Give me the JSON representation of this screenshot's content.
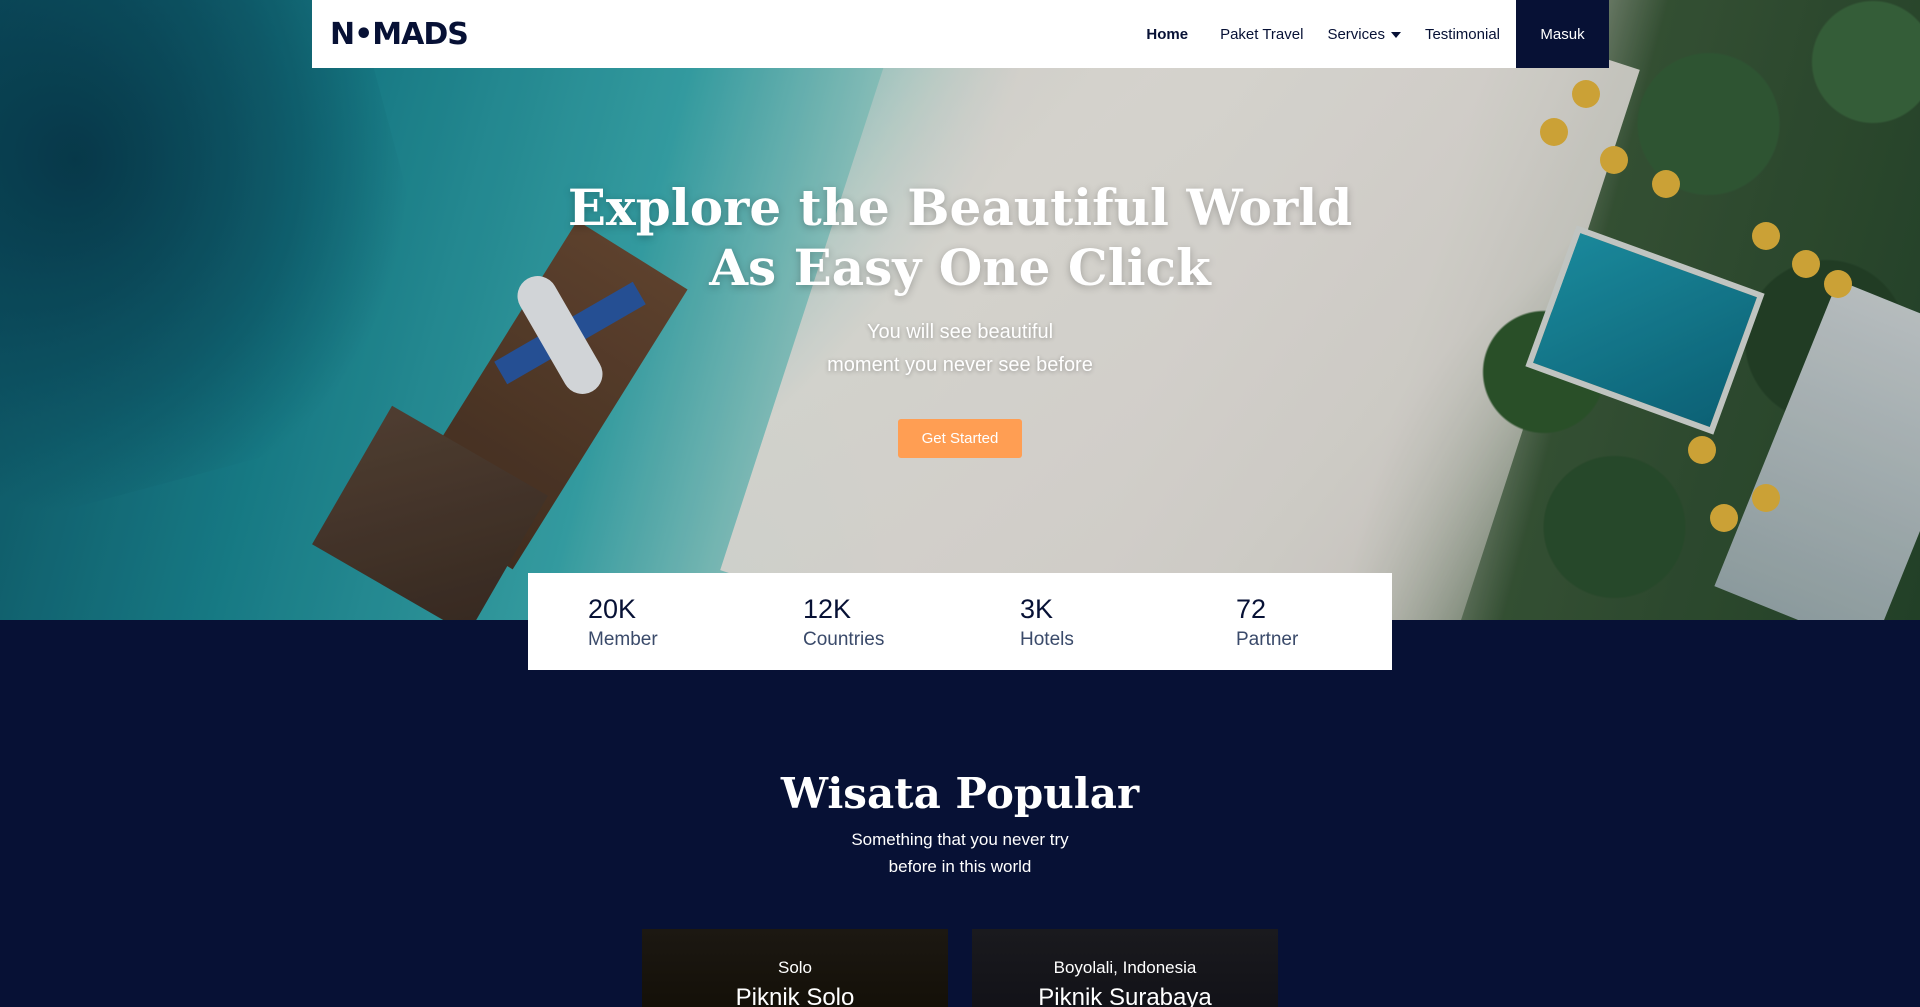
{
  "nav": {
    "logo": "N•MADS",
    "links": [
      "Home",
      "Paket Travel",
      "Services",
      "Testimonial"
    ],
    "login_label": "Masuk"
  },
  "hero": {
    "title_line1": "Explore the Beautiful World",
    "title_line2": "As Easy One Click",
    "subtitle_line1": "You will see beautiful",
    "subtitle_line2": "moment you never see before",
    "cta_label": "Get Started"
  },
  "stats": [
    {
      "value": "20K",
      "label": "Member"
    },
    {
      "value": "12K",
      "label": "Countries"
    },
    {
      "value": "3K",
      "label": "Hotels"
    },
    {
      "value": "72",
      "label": "Partner"
    }
  ],
  "popular": {
    "title": "Wisata Popular",
    "subtitle_line1": "Something that you never try",
    "subtitle_line2": "before in this world",
    "cards": [
      {
        "location": "Solo",
        "name": "Piknik Solo"
      },
      {
        "location": "Boyolali, Indonesia",
        "name": "Piknik Surabaya"
      }
    ]
  },
  "colors": {
    "navy": "#071135",
    "accent_orange": "#ff9e53",
    "white": "#ffffff"
  }
}
